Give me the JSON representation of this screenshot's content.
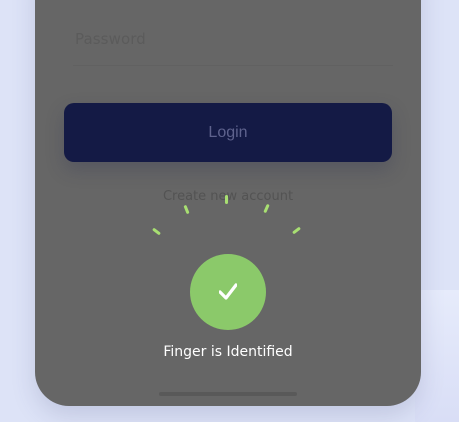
{
  "form": {
    "password_placeholder": "Password",
    "login_label": "Login",
    "create_account_label": "Create new account"
  },
  "fingerprint_status": {
    "message": "Finger is Identified",
    "state": "success",
    "icon": "check-icon",
    "color": "#8bc96a"
  },
  "colors": {
    "overlay": "#666666",
    "login_button": "#141a45",
    "page_background": "#dde3f7"
  }
}
